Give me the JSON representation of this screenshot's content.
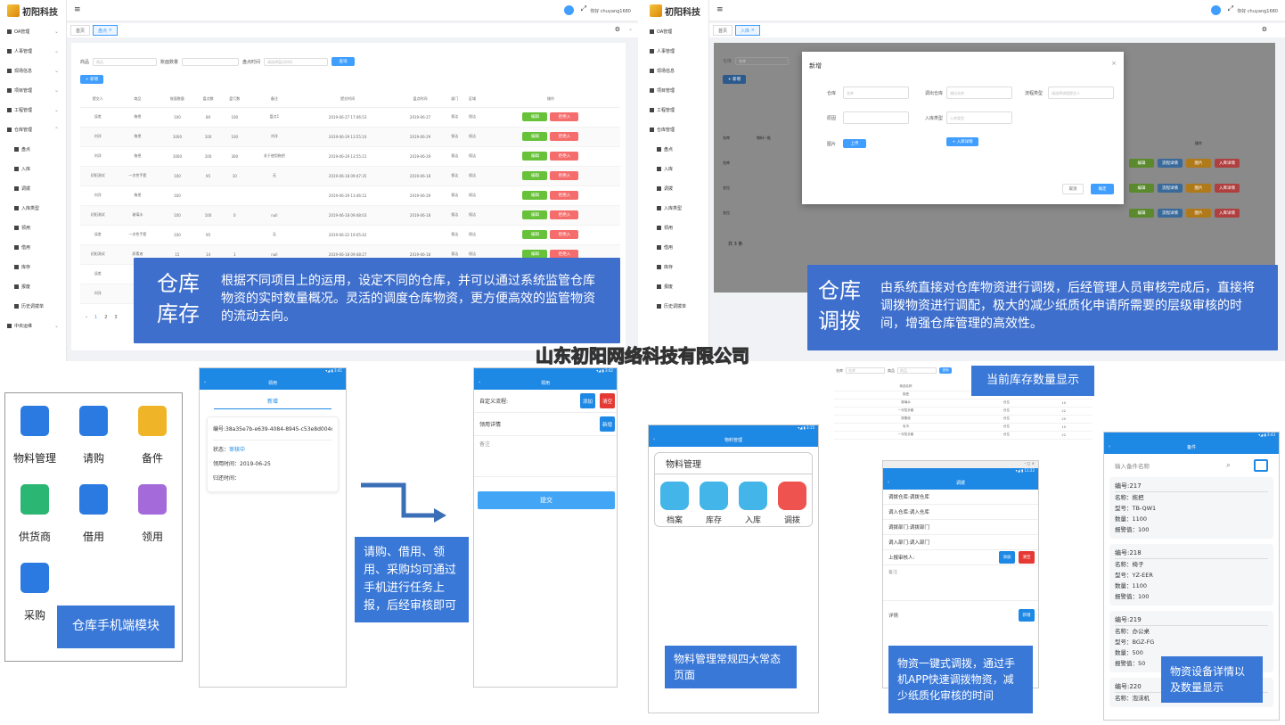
{
  "company": "山东初阳网络科技有限公司",
  "q1": {
    "logo": "初阳科技",
    "greeting": "你好 chuyang1680",
    "menu": [
      "OA管理",
      "人事管理",
      "现场信息",
      "项目管理",
      "工程管理",
      "仓库管理"
    ],
    "submenu": [
      "盘点",
      "入库",
      "调拨",
      "入库类型",
      "领用",
      "借用",
      "库存",
      "报废",
      "历史调拨单"
    ],
    "menu_bottom": "中央运维",
    "tabs": [
      "首页",
      "盘点"
    ],
    "filter": {
      "item_label": "商品",
      "item_ph": "商品",
      "qty_label": "账面数量",
      "time_label": "盘点时间",
      "time_ph": "请选择盘点时间",
      "search": "查询"
    },
    "add": "+ 新增",
    "headers": [
      "提交人",
      "商品",
      "账面数量",
      "盘点数",
      "盘亏数",
      "备注",
      "提交时间",
      "盘点时间",
      "部门",
      "区域",
      "操作"
    ],
    "rows": [
      [
        "误差",
        "拖把",
        "100",
        "80",
        "100",
        "盘点1",
        "2019-06-27 17:06:53",
        "2019-06-27",
        "保洁",
        "保洁"
      ],
      [
        "刘洋",
        "拖把",
        "1000",
        "100",
        "100",
        "刘洋",
        "2019-06-29 13:55:10",
        "2019-06-29",
        "保洁",
        "保洁"
      ],
      [
        "刘洋",
        "拖把",
        "1000",
        "100",
        "300",
        "关于使用拖把",
        "2019-06-29 13:55:21",
        "2019-06-29",
        "保洁",
        "保洁"
      ],
      [
        "初阳测试",
        "一次性手套",
        "100",
        "95",
        "10",
        "无",
        "2019-06-18 09:47:35",
        "2019-06-18",
        "保洁",
        "保洁"
      ],
      [
        "刘洋",
        "拖把",
        "100",
        "",
        "",
        "",
        "2019-06-29 13:46:12",
        "2019-06-29",
        "保洁",
        "保洁"
      ],
      [
        "初阳测试",
        "玻璃水",
        "100",
        "100",
        "0",
        "null",
        "2019-06-18 09:48:03",
        "2019-06-18",
        "保洁",
        "保洁"
      ],
      [
        "误差",
        "一次性手套",
        "100",
        "95",
        "",
        "无",
        "2019-06-22 19:05:42",
        "",
        "保洁",
        "保洁"
      ],
      [
        "初阳测试",
        "尿素液",
        "15",
        "14",
        "1",
        "null",
        "2019-06-18 09:48:27",
        "2019-06-18",
        "保洁",
        "保洁"
      ],
      [
        "误差",
        "",
        "",
        "",
        "",
        "",
        "",
        "",
        "",
        ""
      ],
      [
        "刘洋",
        "",
        "",
        "",
        "",
        "",
        "",
        "",
        "",
        ""
      ]
    ],
    "edit": "编辑",
    "reject": "拒绝入",
    "pager": [
      "1",
      "2",
      "3"
    ],
    "overlay_title": "仓库库存",
    "overlay_text": "根据不同项目上的运用，设定不同的仓库，并可以通过系统监管仓库物资的实时数量概况。灵活的调度仓库物资，更方便高效的监管物资的流动去向。"
  },
  "q2": {
    "logo": "初阳科技",
    "greeting": "你好 chuyang1680",
    "menu": [
      "OA管理",
      "人事管理",
      "现场信息",
      "项目管理",
      "工程管理",
      "仓库管理"
    ],
    "submenu": [
      "盘点",
      "入库",
      "调拨",
      "入库类型",
      "领用",
      "借用",
      "库存",
      "报废",
      "历史调拨单"
    ],
    "tabs": [
      "首页",
      "入库"
    ],
    "filter": {
      "label": "仓库",
      "ph": "仓库"
    },
    "add": "+ 新增",
    "headers": [
      "仓库",
      "商品名称",
      "",
      "",
      "",
      "",
      "操作"
    ],
    "rows": [
      [
        "仓库",
        "物料一批"
      ],
      [
        "仓位",
        ""
      ],
      [
        "仓位",
        ""
      ]
    ],
    "actions": [
      "编辑",
      "流程详情",
      "图片",
      "入库详情"
    ],
    "pager": "共 3 条",
    "dialog": {
      "title": "新增",
      "warehouse": "仓库",
      "warehouse_ph": "仓库",
      "allot_wh": "调出仓库",
      "allot_wh_ph": "调出仓库",
      "flow_type": "流程类型",
      "flow_type_ph": "请选择流程提交人",
      "reason": "原因",
      "in_type": "入库类型",
      "in_type_ph": "入库类型",
      "image": "图片",
      "upload": "上传",
      "add_detail": "+ 入库详情",
      "cancel": "取消",
      "ok": "确定"
    },
    "overlay_title": "仓库调拨",
    "overlay_text": "由系统直接对仓库物资进行调拨，后经管理人员审核完成后，直接将调拨物资进行调配，极大的减少纸质化申请所需要的层级审核的时间，增强仓库管理的高效性。"
  },
  "q3": {
    "icons": [
      {
        "label": "物料管理",
        "icon": "cart-icon"
      },
      {
        "label": "请购",
        "icon": "bag-icon"
      },
      {
        "label": "备件",
        "icon": "binders-icon"
      },
      {
        "label": "供货商",
        "icon": "invoice-icon"
      },
      {
        "label": "借用",
        "icon": "wallet-icon"
      },
      {
        "label": "领用",
        "icon": "stamp-icon"
      },
      {
        "label": "采购",
        "icon": "bag-icon"
      }
    ],
    "module_label": "仓库手机端模块",
    "phone1": {
      "title": "领用",
      "tab": "新增",
      "code": "编号:38a35e7b-e639-4084-8945-c53e8d004c9a",
      "status_label": "状态：",
      "status": "审核中",
      "use_time": "领用时间：2019-06-25",
      "return_time": "归还时间："
    },
    "phone2": {
      "title": "领用",
      "custom_flow": "自定义流程:",
      "add": "添加",
      "clear": "清空",
      "detail": "领用详情",
      "new": "新增",
      "remark": "备注",
      "submit": "提交"
    },
    "callout": "请购、借用、领用、采购均可通过手机进行任务上报，后经审核即可"
  },
  "q4": {
    "stock_label": "当前库存数量显示",
    "stock_filter": {
      "a": "仓库",
      "a_ph": "仓库",
      "b": "商品",
      "b_ph": "商品",
      "btn": "查询"
    },
    "stock_rows": [
      [
        "商品名称",
        "仓库",
        "数量"
      ],
      [
        "拖把",
        "仓位",
        "10"
      ],
      [
        "玻璃水",
        "仓位",
        "10"
      ],
      [
        "一次性手套",
        "仓位",
        "22"
      ],
      [
        "尿素液",
        "仓位",
        "20"
      ],
      [
        "毛巾",
        "仓位",
        "10"
      ],
      [
        "一次性手套",
        "仓位",
        "22"
      ]
    ],
    "phoneA": {
      "title": "物料管理",
      "section": "物料管理",
      "items": [
        "档案",
        "库存",
        "入库",
        "调拨"
      ]
    },
    "phoneA_label": "物料管理常规四大常态页面",
    "phoneB": {
      "title": "调拨",
      "rows": [
        "调拨仓库:调拨仓库",
        "调入仓库:调入仓库",
        "调拨部门:调拨部门",
        "调入部门:调入部门",
        "上报审核人:"
      ],
      "add": "添加",
      "clear": "清空",
      "remark": "备注",
      "detail": "详情",
      "new": "新增"
    },
    "phoneB_label": "物资一键式调拨，通过手机APP快速调拨物资，减少纸质化审核的时间",
    "phoneC": {
      "title": "备件",
      "search_ph": "输入备件名称",
      "cards": [
        {
          "code": "编号:217",
          "name": "名称：拖把",
          "model": "型号：TB-QW1",
          "qty": "数量：1100",
          "warn": "报警值：100"
        },
        {
          "code": "编号:218",
          "name": "名称：椅子",
          "model": "型号：YZ-EER",
          "qty": "数量：1100",
          "warn": "报警值：100"
        },
        {
          "code": "编号:219",
          "name": "名称：办公桌",
          "model": "型号：BGZ-FG",
          "qty": "数量：500",
          "warn": "报警值：50"
        },
        {
          "code": "编号:220",
          "name": "名称：泡沫机",
          "model": "",
          "qty": "",
          "warn": ""
        }
      ]
    },
    "phoneC_label": "物资设备详情以及数量显示"
  }
}
